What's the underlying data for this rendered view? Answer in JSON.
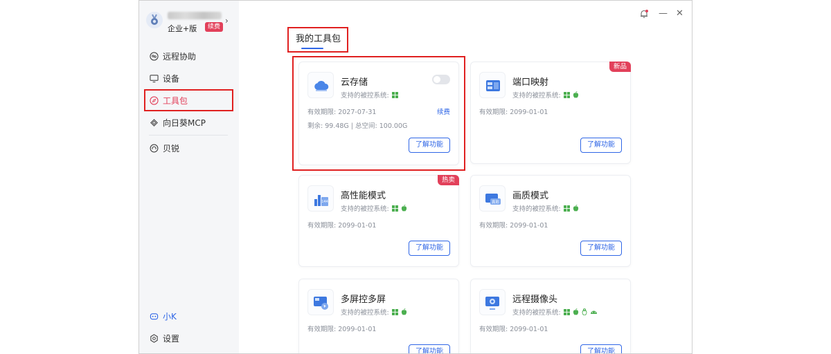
{
  "profile": {
    "edition": "企业+版",
    "renew_badge": "续费"
  },
  "sidebar": {
    "items": [
      {
        "label": "远程协助",
        "icon": "remote-assist-icon"
      },
      {
        "label": "设备",
        "icon": "monitor-icon"
      },
      {
        "label": "工具包",
        "icon": "compass-icon",
        "active": true
      },
      {
        "label": "向日葵MCP",
        "icon": "mcp-icon"
      },
      {
        "label": "贝锐",
        "icon": "oray-icon"
      }
    ],
    "bottom": [
      {
        "label": "小K",
        "icon": "robot-icon"
      },
      {
        "label": "设置",
        "icon": "gear-icon"
      }
    ]
  },
  "main": {
    "heading": "我的工具包"
  },
  "cards": [
    {
      "title": "云存储",
      "os_label": "支持的被控系统:",
      "expiry": "有效期限: 2027-07-31",
      "renew": "续费",
      "storage": "剩余: 99.48G  |  总空间: 100.00G",
      "button": "了解功能",
      "icon": "cloud-storage-icon"
    },
    {
      "title": "端口映射",
      "os_label": "支持的被控系统:",
      "expiry": "有效期限: 2099-01-01",
      "button": "了解功能",
      "ribbon": "新品",
      "icon": "port-mapping-icon"
    },
    {
      "title": "高性能模式",
      "os_label": "支持的被控系统:",
      "expiry": "有效期限: 2099-01-01",
      "button": "了解功能",
      "ribbon": "热卖",
      "icon": "high-performance-icon",
      "icon_text": "144"
    },
    {
      "title": "画质模式",
      "os_label": "支持的被控系统:",
      "expiry": "有效期限: 2099-01-01",
      "button": "了解功能",
      "icon": "image-quality-icon",
      "icon_text": "真彩"
    },
    {
      "title": "多屏控多屏",
      "os_label": "支持的被控系统:",
      "expiry": "有效期限: 2099-01-01",
      "button": "了解功能",
      "icon": "multi-screen-icon"
    },
    {
      "title": "远程摄像头",
      "os_label": "支持的被控系统:",
      "expiry": "有效期限: 2099-01-01",
      "button": "了解功能",
      "icon": "remote-camera-icon"
    }
  ],
  "colors": {
    "accent": "#2f66e6",
    "active": "#e2405a",
    "windows_icon": "#4caf50",
    "highlight_box": "#e02020"
  }
}
